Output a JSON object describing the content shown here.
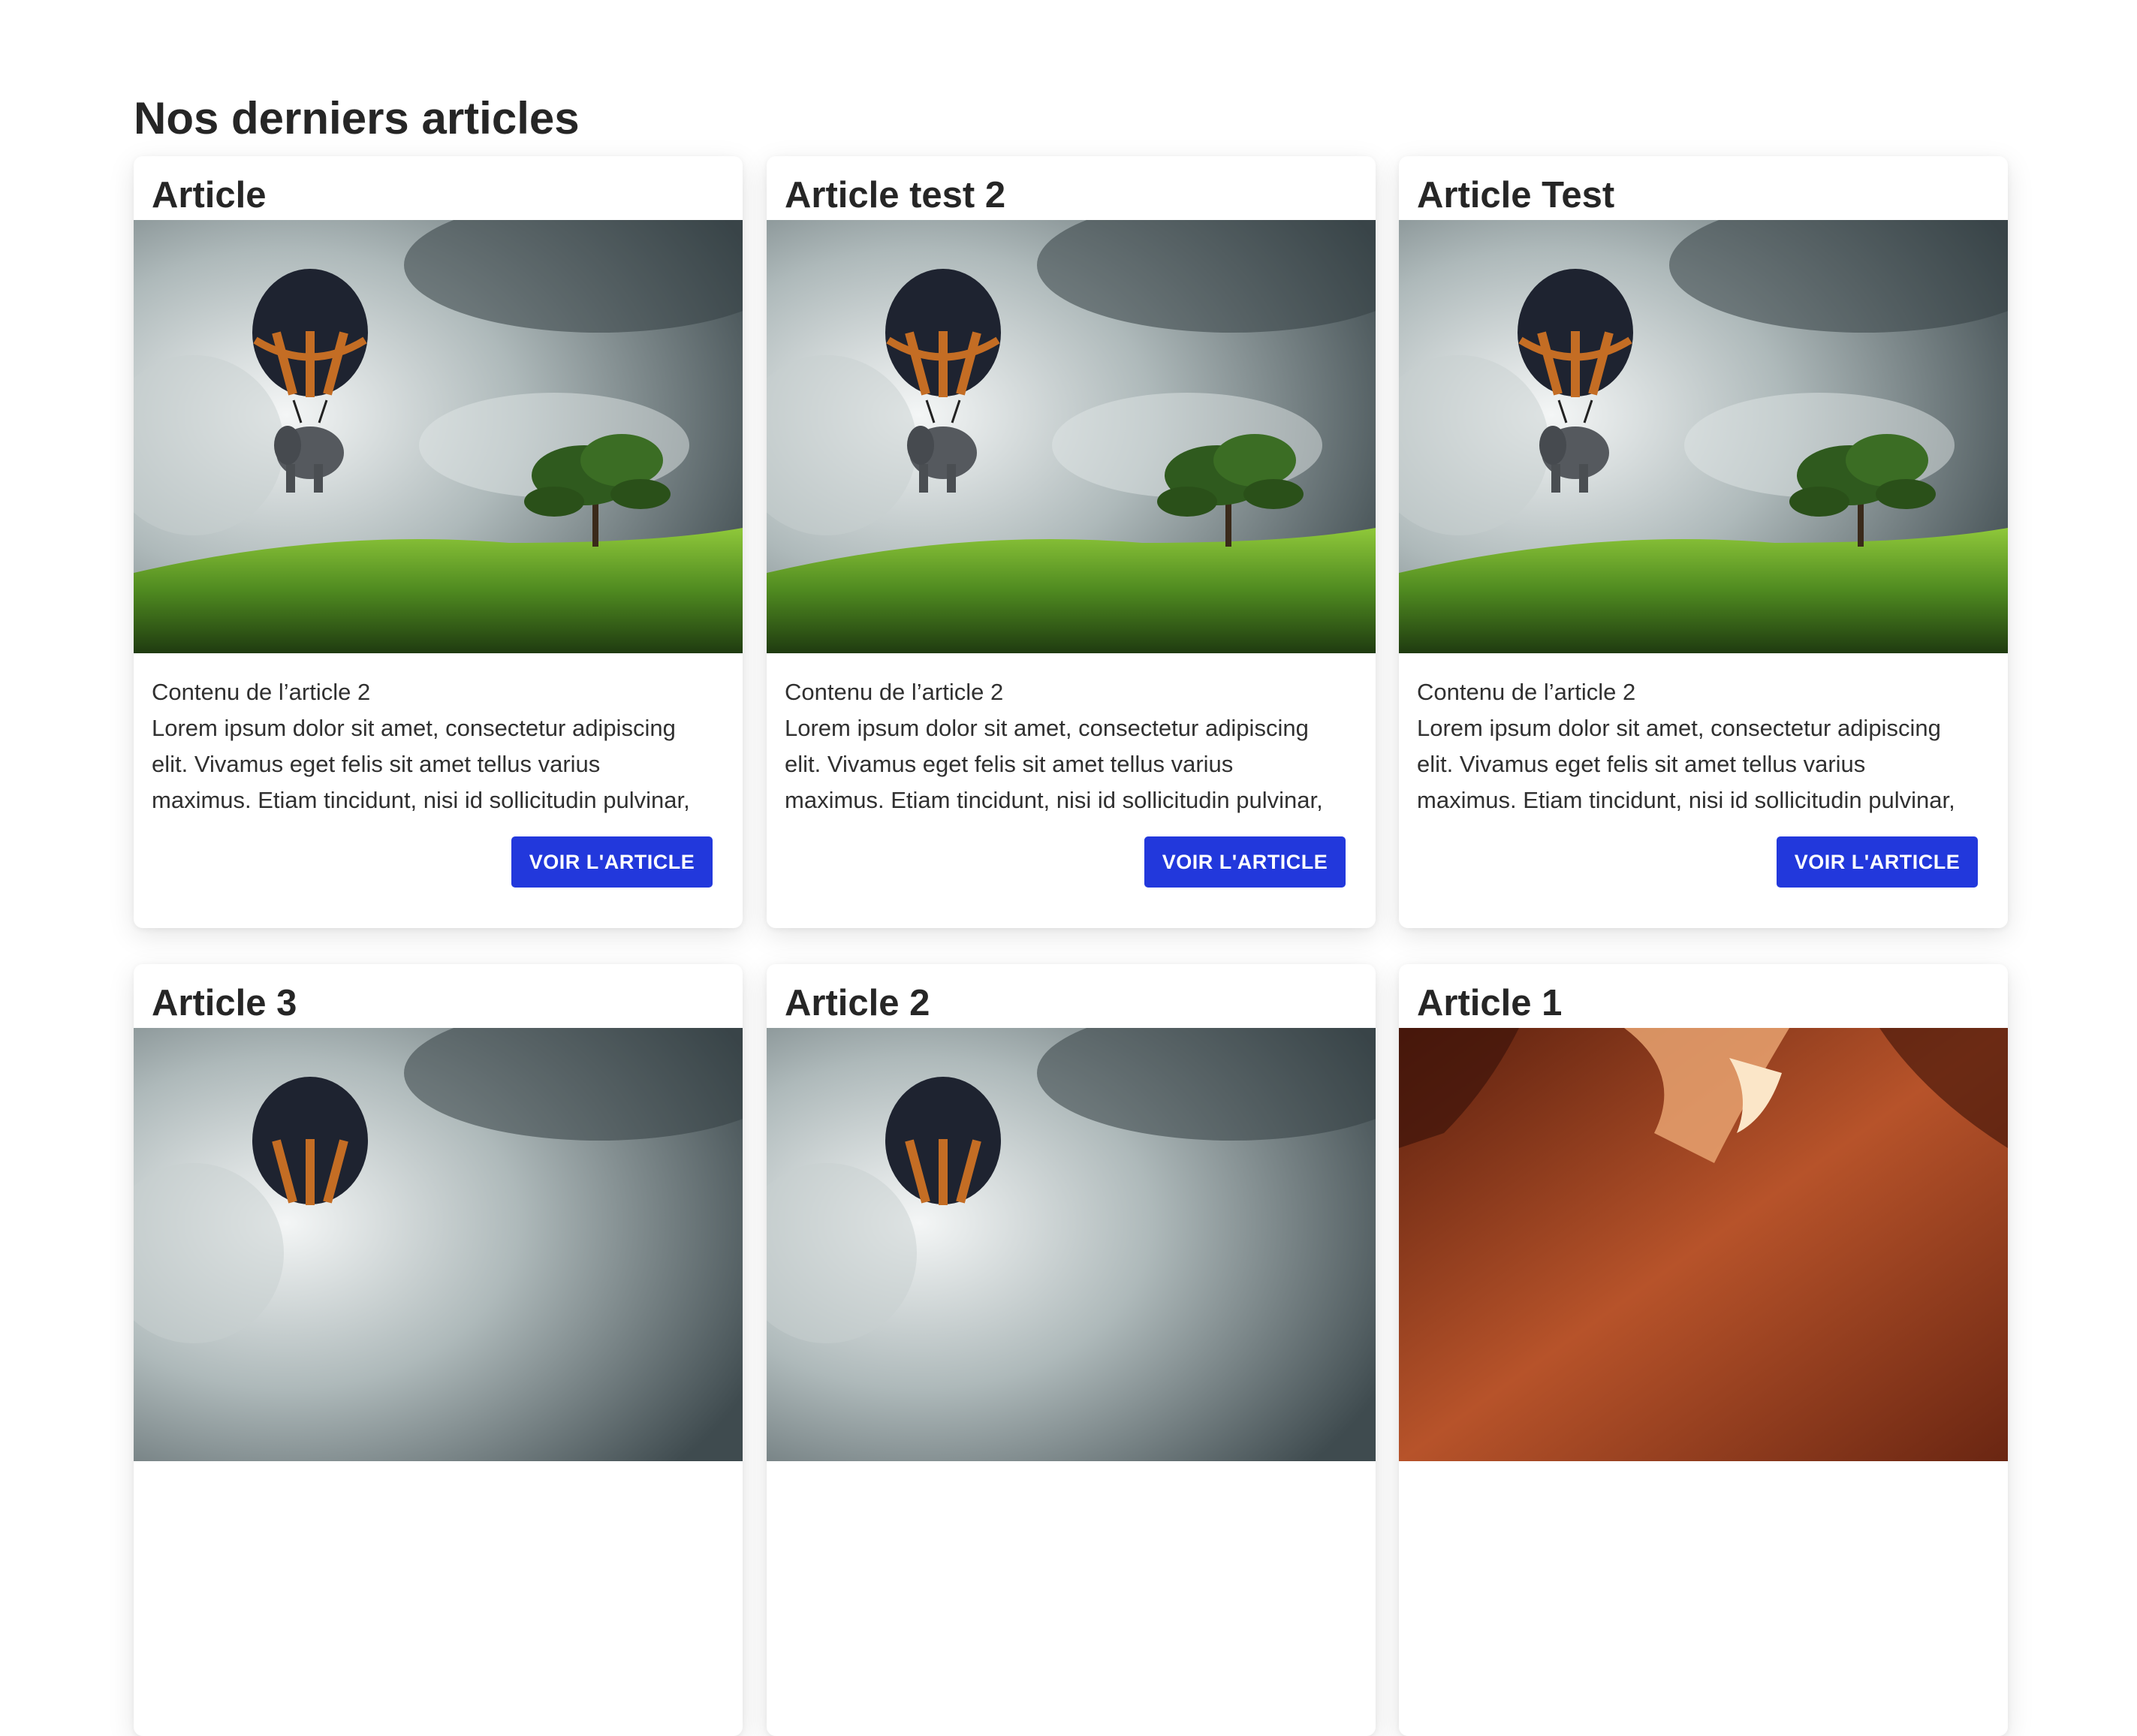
{
  "page": {
    "title": "Nos derniers articles"
  },
  "articles": [
    {
      "title": "Article",
      "image": "balloon-elephant-landscape",
      "excerpt_heading": "Contenu de l’article 2",
      "excerpt_lines": [
        "Lorem ipsum dolor sit amet, consectetur adipiscing",
        "elit. Vivamus eget felis sit amet tellus varius",
        "maximus. Etiam tincidunt, nisi id sollicitudin pulvinar,"
      ],
      "button_label": "VOIR L'ARTICLE"
    },
    {
      "title": "Article test 2",
      "image": "balloon-elephant-landscape",
      "excerpt_heading": "Contenu de l’article 2",
      "excerpt_lines": [
        "Lorem ipsum dolor sit amet, consectetur adipiscing",
        "elit. Vivamus eget felis sit amet tellus varius",
        "maximus. Etiam tincidunt, nisi id sollicitudin pulvinar,"
      ],
      "button_label": "VOIR L'ARTICLE"
    },
    {
      "title": "Article Test",
      "image": "balloon-elephant-landscape",
      "excerpt_heading": "Contenu de l’article 2",
      "excerpt_lines": [
        "Lorem ipsum dolor sit amet, consectetur adipiscing",
        "elit. Vivamus eget felis sit amet tellus varius",
        "maximus. Etiam tincidunt, nisi id sollicitudin pulvinar,"
      ],
      "button_label": "VOIR L'ARTICLE"
    },
    {
      "title": "Article 3",
      "image": "balloon-elephant-landscape"
    },
    {
      "title": "Article 2",
      "image": "balloon-elephant-landscape"
    },
    {
      "title": "Article 1",
      "image": "red-canyon"
    }
  ],
  "colors": {
    "button": "#2238dc",
    "title": "#262626"
  }
}
